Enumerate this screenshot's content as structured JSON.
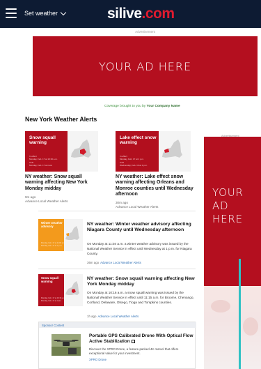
{
  "header": {
    "location_label": "Set weather",
    "logo_main": "silive",
    "logo_accent": ".com"
  },
  "ads": {
    "top_label": "Advertisement",
    "top_text": "YOUR AD HERE",
    "right_label": "Advertisement",
    "right_line1": "YOUR",
    "right_line2": "AD HERE"
  },
  "coverage": {
    "prefix": "Coverage brought to you by",
    "sponsor_name": "Your Company Name"
  },
  "section_title": "New York Weather Alerts",
  "cards": [
    {
      "image_label_line1": "Snow squall",
      "image_label_line2": "warning",
      "image_meta_from_label": "In effect",
      "image_meta_from": "Monday, Feb. 17 at 10:16 a.m.",
      "image_meta_until_label": "Until",
      "image_meta_until": "Monday, Feb. 17 at noon",
      "title": "NY weather: Snow squall warning affecting New York Monday midday",
      "time": "9m ago",
      "source": "Advance Local Weather Alerts"
    },
    {
      "image_label_line1": "Lake effect snow",
      "image_label_line2": "warning",
      "image_meta_from_label": "In effect",
      "image_meta_from": "Monday, Feb. 17 at 1 p.m.",
      "image_meta_until_label": "Until",
      "image_meta_until": "Wednesday, Feb. 19 at 1 p.m.",
      "title": "NY weather: Lake effect snow warning affecting Orleans and Monroe counties until Wednesday afternoon",
      "time": "30m ago",
      "source": "Advance Local Weather Alerts"
    }
  ],
  "list_items": [
    {
      "image_label_line1": "Winter weather",
      "image_label_line2": "advisory",
      "image_meta_from": "Monday, Feb. 17 at 11:04 a.m.",
      "image_meta_until": "Monday, Feb. 17 at 7 p.m.",
      "image_color": "#f39a1c",
      "title": "NY weather: Winter weather advisory affecting Niagara County until Wednesday afternoon",
      "body": "On Monday at 11:04 a.m. a winter weather advisory was issued by the National Weather Service in effect until Wednesday at 1 p.m. for Niagara County.",
      "time": "36m ago",
      "source": "Advance Local Weather Alerts"
    },
    {
      "image_label_line1": "Snow squall",
      "image_label_line2": "warning",
      "image_meta_from": "Monday, Feb. 17 at 10:16 a.m.",
      "image_meta_until": "Monday, Feb. 17 at noon",
      "image_color": "#b20f1e",
      "title": "NY weather: Snow squall warning affecting New York Monday midday",
      "body": "On Monday at 10:16 a.m. a snow squall warning was issued by the National Weather Service in effect until 11:15 a.m. for Broome, Chenango, Cortland, Delaware, Otsego, Tioga and Tompkins counties.",
      "time": "1h ago",
      "source": "Advance Local Weather Alerts"
    }
  ],
  "sponsored": {
    "tag": "Sponsor Content",
    "title": "Portable GPS Calibrated Drone With Optical Flow Active Stabilization",
    "body": "Discover the XPRO Drone, a feature-packed 4K marvel that offers exceptional value for your investment.",
    "source": "XPRO Drone"
  },
  "colors": {
    "topbar": "#0d1b33",
    "ad_red": "#b40f1f",
    "link_blue": "#2d6fb5",
    "teal": "#2fc1c4"
  }
}
